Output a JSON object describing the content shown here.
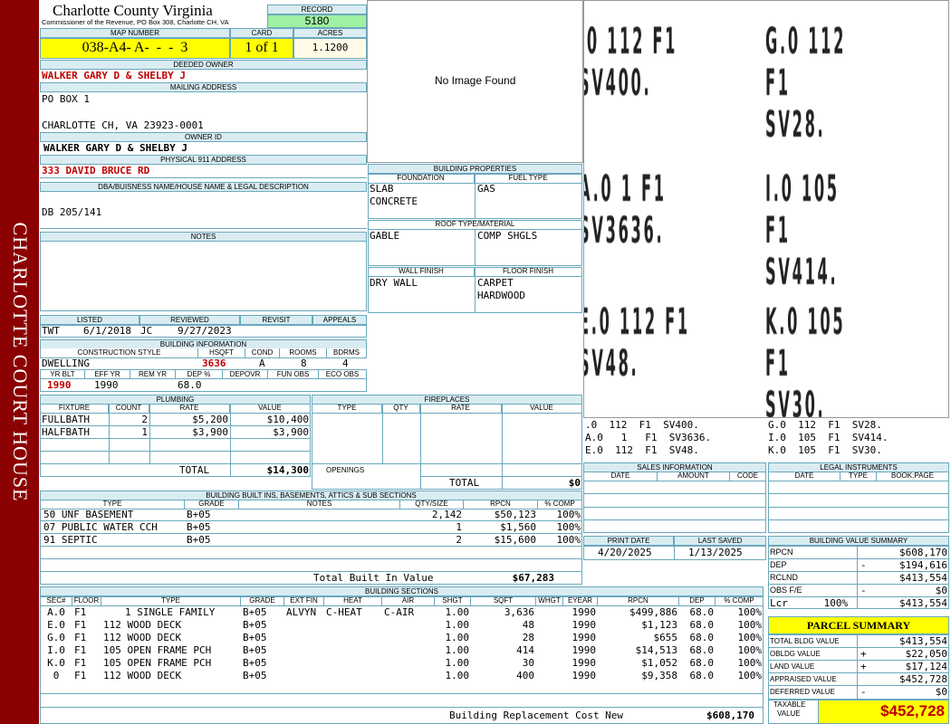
{
  "side_banner": "CHARLOTTE COURT HOUSE",
  "county": {
    "title": "Charlotte County Virginia",
    "subtitle": "Commissioner of the Revenue, PO Box 308, Charlotte CH, VA"
  },
  "record": {
    "label": "RECORD",
    "value": "5180"
  },
  "map": {
    "label": "MAP NUMBER",
    "value": "038-A4- A-  -  -  3"
  },
  "card": {
    "label": "CARD",
    "value": "1 of 1"
  },
  "acres": {
    "label": "ACRES",
    "value": "1.1200"
  },
  "deeded_owner": {
    "label": "DEEDED OWNER",
    "value": "WALKER GARY D & SHELBY J"
  },
  "mailing": {
    "label": "MAILING ADDRESS",
    "line1": "PO BOX 1",
    "line2": "",
    "line3": "CHARLOTTE CH, VA 23923-0001"
  },
  "owner_id": {
    "label": "OWNER ID",
    "value": "WALKER GARY D & SHELBY J"
  },
  "address911": {
    "label": "PHYSICAL 911 ADDRESS",
    "value": "333 DAVID BRUCE RD"
  },
  "dba": {
    "label": "DBA/BUISNESS NAME/HOUSE NAME & LEGAL DESCRIPTION",
    "value": "DB 205/141"
  },
  "notes": {
    "label": "NOTES",
    "value": ""
  },
  "photo": {
    "text": "No Image Found"
  },
  "building_properties": {
    "label": "BUILDING PROPERTIES",
    "foundation_label": "FOUNDATION",
    "fuel_label": "FUEL TYPE",
    "foundation1": "SLAB",
    "foundation2": "CONCRETE",
    "fuel": "GAS",
    "roof_label": "ROOF TYPE/MATERIAL",
    "roof_type": "GABLE",
    "roof_material": "COMP SHGLS",
    "wall_label": "WALL FINISH",
    "floor_label": "FLOOR FINISH",
    "wall": "DRY WALL",
    "floor1": "CARPET",
    "floor2": "HARDWOOD"
  },
  "sketch": {
    "rows": [
      [
        "A.0   1   F1  SV3636.",
        "I.0  105  F1  SV414."
      ],
      [
        ".0  112  F1  SV400.",
        "G.0  112  F1  SV28."
      ],
      [
        "E.0  112  F1  SV48.",
        "K.0  105  F1  SV30."
      ]
    ],
    "big": [
      [
        ".0  112  F1  SV400.",
        "G.0  112  F1  SV28."
      ],
      [
        "A.0  1   F1  SV3636.",
        "I.0  105  F1  SV414."
      ],
      [
        "E.0  112  F1  SV48.",
        "K.0  105  F1  SV30."
      ]
    ]
  },
  "listing": {
    "listed_label": "LISTED",
    "reviewed_label": "REVIEWED",
    "revisit_label": "REVISIT",
    "appeals_label": "APPEALS",
    "listed_by": "TWT",
    "listed_date": "6/1/2018",
    "reviewed_by": "JC",
    "reviewed_date": "9/27/2023"
  },
  "building_info": {
    "label": "BUILDING INFORMATION",
    "style_label": "CONSTRUCTION STYLE",
    "hsqft_label": "HSQFT",
    "cond_label": "COND",
    "rooms_label": "ROOMS",
    "bdrms_label": "BDRMS",
    "style": "DWELLING",
    "hsqft": "3636",
    "cond": "A",
    "rooms": "8",
    "bdrms": "4",
    "yrblt_label": "YR BLT",
    "effyr_label": "EFF YR",
    "remyr_label": "REM YR",
    "dep_label": "DEP %",
    "depovr_label": "DEPOVR",
    "funobs_label": "FUN OBS",
    "ecoobs_label": "ECO OBS",
    "yrblt": "1990",
    "effyr": "1990",
    "dep": "68.0"
  },
  "plumbing": {
    "label": "PLUMBING",
    "cols": [
      "FIXTURE",
      "COUNT",
      "RATE",
      "VALUE"
    ],
    "rows": [
      [
        "FULLBATH",
        "2",
        "$5,200",
        "$10,400"
      ],
      [
        "HALFBATH",
        "1",
        "$3,900",
        "$3,900"
      ]
    ],
    "total_label": "TOTAL",
    "total": "$14,300"
  },
  "fireplaces": {
    "label": "FIREPLACES",
    "cols": [
      "TYPE",
      "QTY",
      "RATE",
      "VALUE"
    ],
    "openings_label": "OPENINGS",
    "total_label": "TOTAL",
    "total": "$0"
  },
  "sales": {
    "label": "SALES INFORMATION",
    "cols": [
      "DATE",
      "AMOUNT",
      "CODE"
    ]
  },
  "legal": {
    "label": "LEGAL INSTRUMENTS",
    "cols": [
      "DATE",
      "TYPE",
      "BOOK:PAGE"
    ]
  },
  "builtins": {
    "label": "BUILDING BUILT INS, BASEMENTS, ATTICS & SUB SECTIONS",
    "cols": [
      "TYPE",
      "GRADE",
      "NOTES",
      "QTY/SIZE",
      "RPCN",
      "% COMP"
    ],
    "rows": [
      [
        "50 UNF BASEMENT",
        "B+05",
        "",
        "2,142",
        "$50,123",
        "100%"
      ],
      [
        "07 PUBLIC WATER CCH",
        "B+05",
        "",
        "1",
        "$1,560",
        "100%"
      ],
      [
        "91 SEPTIC",
        "B+05",
        "",
        "2",
        "$15,600",
        "100%"
      ]
    ],
    "total_label": "Total Built In Value",
    "total": "$67,283"
  },
  "dates": {
    "print_label": "PRINT DATE",
    "saved_label": "LAST SAVED",
    "print": "4/20/2025",
    "saved": "1/13/2025"
  },
  "value_summary": {
    "label": "BUILDING VALUE SUMMARY",
    "rows": [
      [
        "RPCN",
        "",
        "$608,170"
      ],
      [
        "DEP",
        "-",
        "$194,616"
      ],
      [
        "RCLND",
        "",
        "$413,554"
      ],
      [
        "OBS F/E",
        "-",
        "$0"
      ],
      [
        "Lcr      100%",
        "",
        "$413,554"
      ]
    ]
  },
  "parcel": {
    "label": "PARCEL SUMMARY",
    "rows": [
      [
        "TOTAL BLDG VALUE",
        "",
        "$413,554"
      ],
      [
        "OBLDG VALUE",
        "+",
        "$22,050"
      ],
      [
        "LAND VALUE",
        "+",
        "$17,124"
      ],
      [
        "APPRAISED VALUE",
        "",
        "$452,728"
      ],
      [
        "DEFERRED VALUE",
        "-",
        "$0"
      ]
    ],
    "taxable_label1": "TAXABLE",
    "taxable_label2": "VALUE",
    "taxable": "$452,728"
  },
  "sections": {
    "label": "BUILDING SECTIONS",
    "cols": [
      "SEC#",
      "FLOOR",
      "TYPE",
      "GRADE",
      "EXT FIN",
      "HEAT",
      "AIR",
      "SHGT",
      "SQFT",
      "WHGT",
      "EYEAR",
      "RPCN",
      "DEP",
      "% COMP"
    ],
    "rows": [
      [
        "A.0",
        "F1",
        "1 SINGLE FAMILY",
        "B+05",
        "ALVYN",
        "C-HEAT",
        "C-AIR",
        "1.00",
        "3,636",
        "",
        "1990",
        "$499,886",
        "68.0",
        "100%"
      ],
      [
        "E.0",
        "F1",
        "112 WOOD DECK",
        "B+05",
        "",
        "",
        "",
        "1.00",
        "48",
        "",
        "1990",
        "$1,123",
        "68.0",
        "100%"
      ],
      [
        "G.0",
        "F1",
        "112 WOOD DECK",
        "B+05",
        "",
        "",
        "",
        "1.00",
        "28",
        "",
        "1990",
        "$655",
        "68.0",
        "100%"
      ],
      [
        "I.0",
        "F1",
        "105 OPEN FRAME PCH",
        "B+05",
        "",
        "",
        "",
        "1.00",
        "414",
        "",
        "1990",
        "$14,513",
        "68.0",
        "100%"
      ],
      [
        "K.0",
        "F1",
        "105 OPEN FRAME PCH",
        "B+05",
        "",
        "",
        "",
        "1.00",
        "30",
        "",
        "1990",
        "$1,052",
        "68.0",
        "100%"
      ],
      [
        "0",
        "F1",
        "112 WOOD DECK",
        "B+05",
        "",
        "",
        "",
        "1.00",
        "400",
        "",
        "1990",
        "$9,358",
        "68.0",
        "100%"
      ]
    ],
    "total_label": "Building Replacement Cost New",
    "total": "$608,170"
  }
}
